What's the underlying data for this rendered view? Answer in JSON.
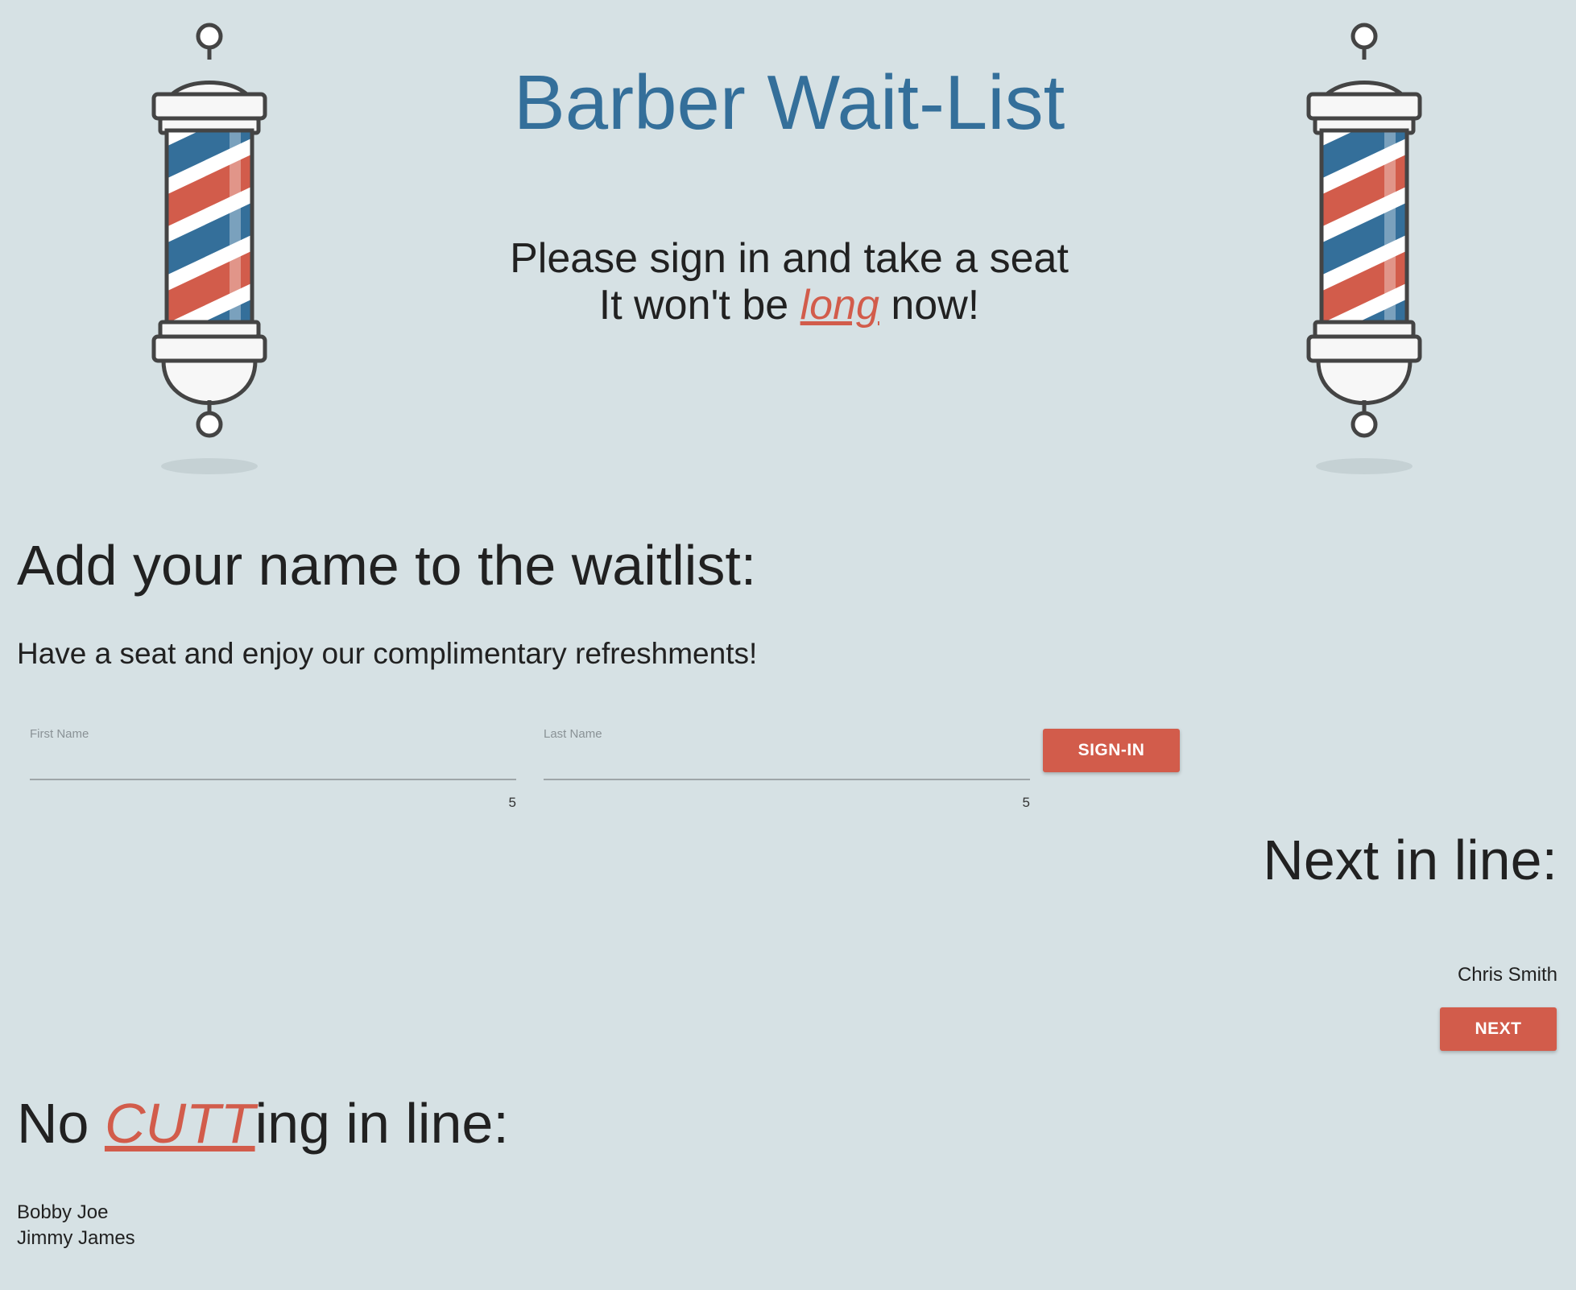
{
  "header": {
    "title": "Barber Wait-List",
    "tagline_line1": "Please sign in and take a seat",
    "tagline_line2_before": "It won't be ",
    "tagline_line2_emphasis": "long",
    "tagline_line2_after": " now!"
  },
  "poles": {
    "icon": "barber-pole-icon",
    "stripe_colors": [
      "#d25c4b",
      "#346f9a"
    ]
  },
  "signin": {
    "heading": "Add your name to the waitlist:",
    "subtitle": "Have a seat and enjoy our complimentary refreshments!",
    "first_name_label": "First Name",
    "first_name_value": "",
    "first_name_counter": "5",
    "last_name_label": "Last Name",
    "last_name_value": "",
    "last_name_counter": "5",
    "button_label": "Sign-In"
  },
  "next_in_line": {
    "heading": "Next in line:",
    "name": "Chris Smith",
    "button_label": "Next"
  },
  "queue": {
    "heading_before": "No ",
    "heading_emphasis": "CUTT",
    "heading_after": "ing in line:",
    "names": [
      "Bobby Joe",
      "Jimmy James"
    ]
  },
  "colors": {
    "background": "#d6e1e4",
    "title": "#346f9a",
    "accent": "#d25c4b"
  }
}
